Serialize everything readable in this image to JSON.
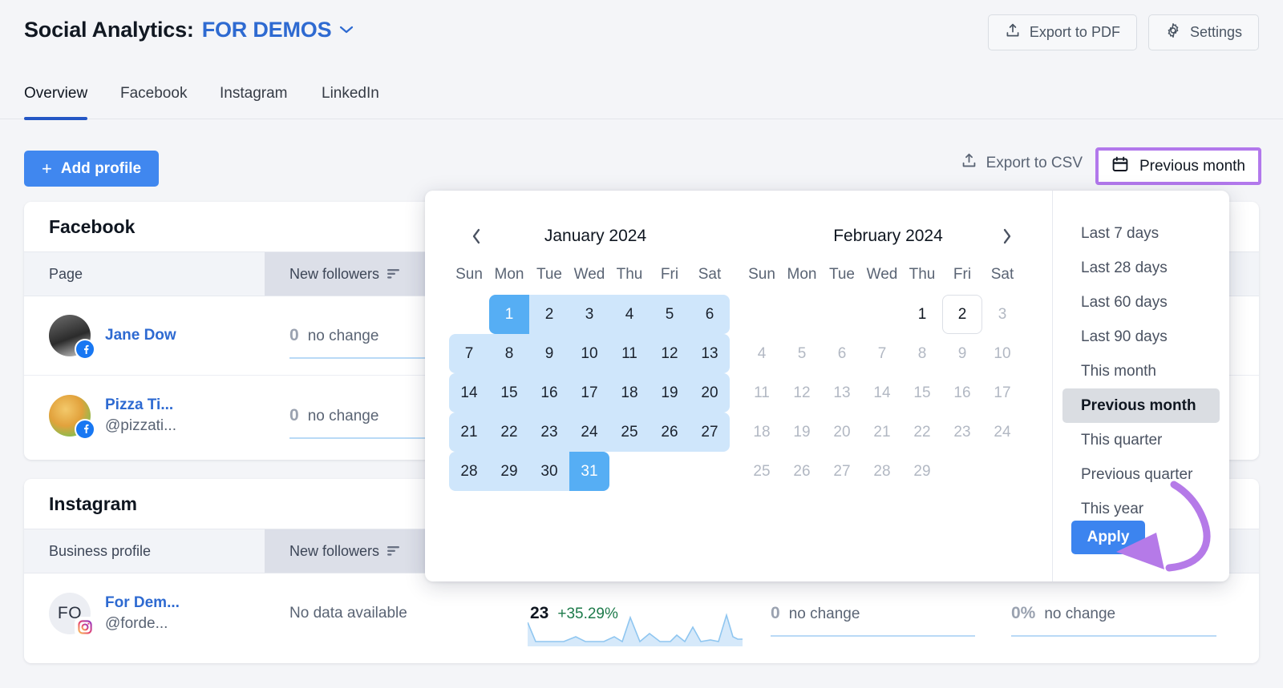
{
  "header": {
    "title_prefix": "Social Analytics:",
    "project_name": "FOR DEMOS",
    "caret_icon": "chevron-down-icon",
    "export_pdf_label": "Export to PDF",
    "export_pdf_icon": "upload-icon",
    "settings_label": "Settings",
    "settings_icon": "gear-icon"
  },
  "tabs": [
    {
      "label": "Overview",
      "active": true
    },
    {
      "label": "Facebook",
      "active": false
    },
    {
      "label": "Instagram",
      "active": false
    },
    {
      "label": "LinkedIn",
      "active": false
    }
  ],
  "toolbar": {
    "add_profile_label": "Add profile",
    "add_profile_icon": "plus-icon",
    "export_csv_label": "Export to CSV",
    "export_csv_icon": "upload-icon",
    "date_range_label": "Previous month",
    "date_range_icon": "calendar-icon",
    "highlight_color": "#b278ec"
  },
  "facebook_card": {
    "title": "Facebook",
    "columns": [
      "Page",
      "New followers",
      "",
      "",
      ""
    ],
    "sort_icon": "sort-descending-icon",
    "rows": [
      {
        "name": "Jane Dow",
        "handle": "",
        "avatar_initials": "",
        "badge": "facebook-icon",
        "new_followers_value": "0",
        "new_followers_note": "no change"
      },
      {
        "name": "Pizza Ti...",
        "handle": "@pizzati...",
        "avatar_initials": "",
        "badge": "facebook-icon",
        "new_followers_value": "0",
        "new_followers_note": "no change"
      }
    ]
  },
  "instagram_card": {
    "title": "Instagram",
    "columns": [
      "Business profile",
      "New followers",
      "",
      "",
      ""
    ],
    "sort_icon": "sort-descending-icon",
    "rows": [
      {
        "name": "For Dem...",
        "handle": "@forde...",
        "avatar_initials": "FO",
        "badge": "instagram-icon",
        "new_followers_note": "No data available",
        "metric2_value": "23",
        "metric2_note": "+35.29%",
        "metric3_value": "0",
        "metric3_note": "no change",
        "metric4_value": "0%",
        "metric4_note": "no change"
      }
    ]
  },
  "datepicker": {
    "prev_icon": "chevron-left-icon",
    "next_icon": "chevron-right-icon",
    "weekdays": [
      "Sun",
      "Mon",
      "Tue",
      "Wed",
      "Thu",
      "Fri",
      "Sat"
    ],
    "months": [
      {
        "title": "January 2024",
        "lead_blanks": 1,
        "days": 31,
        "range_start": 1,
        "range_end": 31
      },
      {
        "title": "February 2024",
        "lead_blanks": 4,
        "days": 29,
        "selectable_max": 2,
        "today": 2
      }
    ],
    "presets": [
      {
        "label": "Last 7 days",
        "active": false
      },
      {
        "label": "Last 28 days",
        "active": false
      },
      {
        "label": "Last 60 days",
        "active": false
      },
      {
        "label": "Last 90 days",
        "active": false
      },
      {
        "label": "This month",
        "active": false
      },
      {
        "label": "Previous month",
        "active": true
      },
      {
        "label": "This quarter",
        "active": false
      },
      {
        "label": "Previous quarter",
        "active": false
      },
      {
        "label": "This year",
        "active": false
      }
    ],
    "apply_label": "Apply"
  },
  "annotation": {
    "arrow_color": "#b57ae8",
    "points_to": "apply-button"
  }
}
